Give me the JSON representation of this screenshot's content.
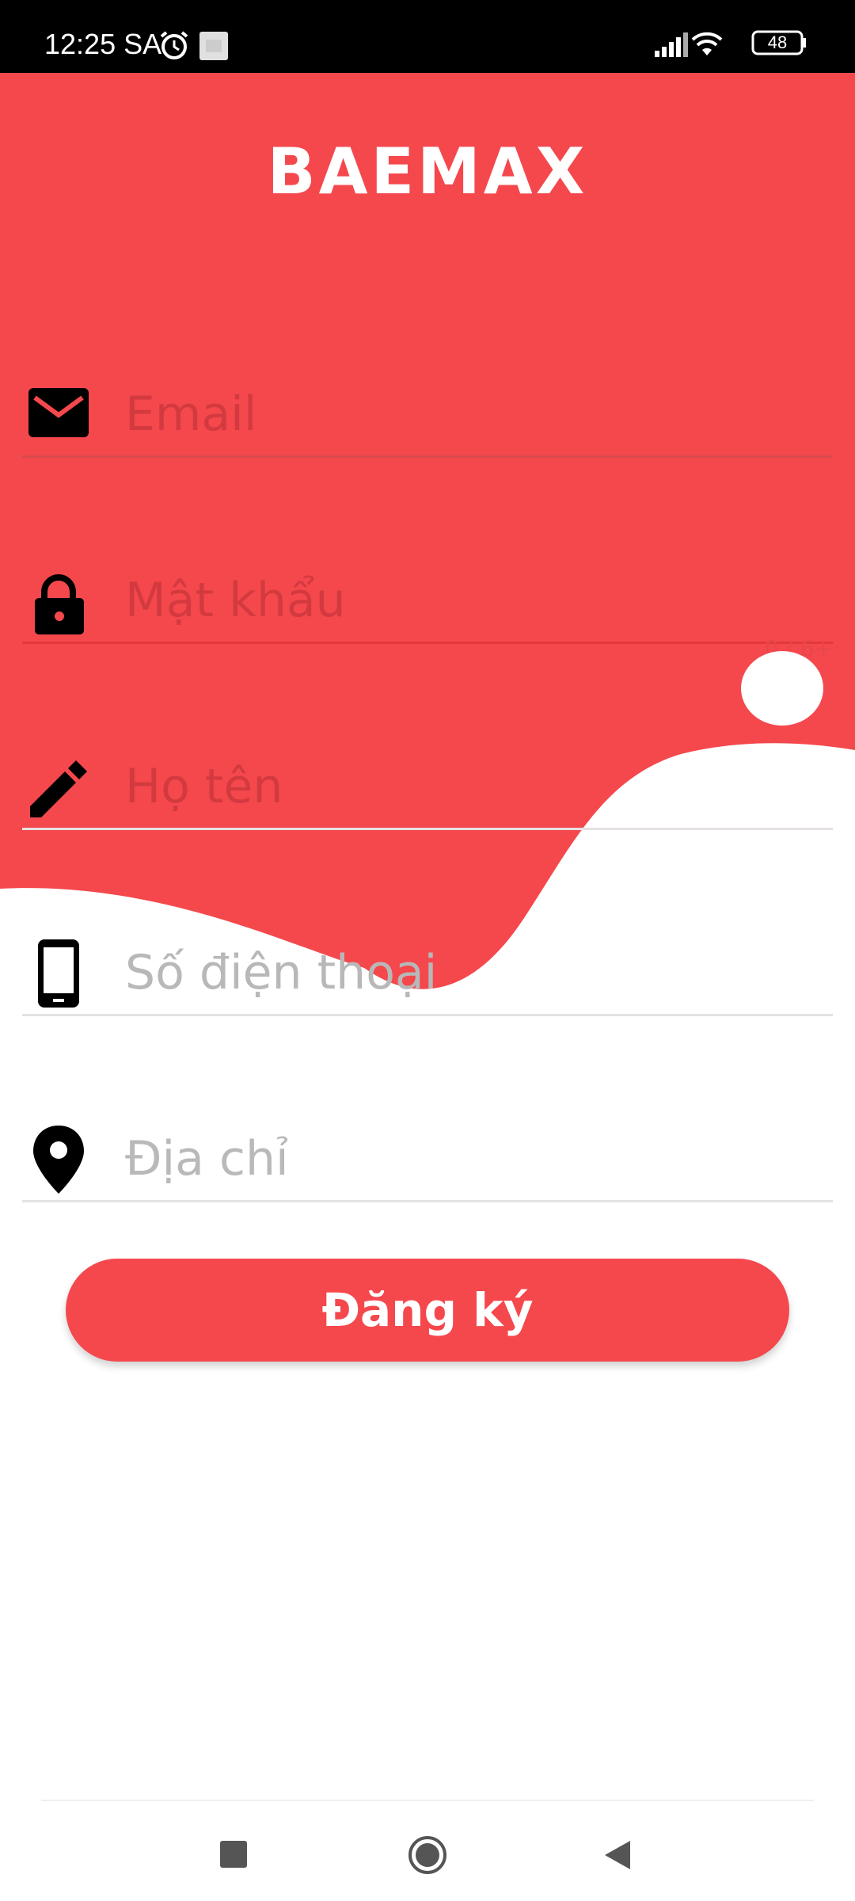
{
  "status_bar": {
    "time": "12:25 SA",
    "battery": "48",
    "icons": [
      "alarm-icon",
      "notification-icon",
      "signal-icon",
      "wifi-icon",
      "battery-icon"
    ]
  },
  "app": {
    "logo": "BAEMAX",
    "accent_color": "#F4484D",
    "fields": {
      "email": {
        "placeholder": "Email",
        "value": "",
        "icon": "mail-icon"
      },
      "password": {
        "placeholder": "Mật khẩu",
        "value": "",
        "icon": "lock-icon",
        "counter": "0 / 6+"
      },
      "full_name": {
        "placeholder": "Họ tên",
        "value": "",
        "icon": "pencil-icon"
      },
      "phone": {
        "placeholder": "Số điện thoại",
        "value": "",
        "icon": "phone-icon"
      },
      "address": {
        "placeholder": "Địa chỉ",
        "value": "",
        "icon": "location-pin-icon"
      }
    },
    "submit_label": "Đăng ký"
  },
  "nav_bar": {
    "buttons": [
      "recent-apps-icon",
      "home-icon",
      "back-icon"
    ]
  }
}
